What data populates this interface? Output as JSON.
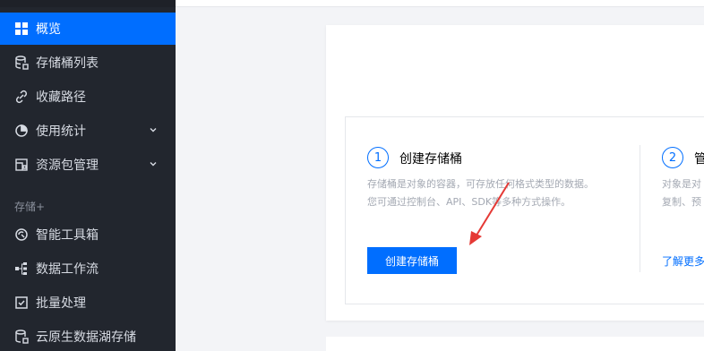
{
  "sidebar": {
    "items": [
      {
        "label": "概览",
        "icon": "grid-icon",
        "active": true
      },
      {
        "label": "存储桶列表",
        "icon": "bucket-icon"
      },
      {
        "label": "收藏路径",
        "icon": "link-icon"
      },
      {
        "label": "使用统计",
        "icon": "pie-chart-icon",
        "expandable": true
      },
      {
        "label": "资源包管理",
        "icon": "package-icon",
        "expandable": true
      },
      {
        "label": "智能工具箱",
        "icon": "toolbox-icon"
      },
      {
        "label": "数据工作流",
        "icon": "workflow-icon"
      },
      {
        "label": "批量处理",
        "icon": "checkbox-icon"
      },
      {
        "label": "云原生数据湖存储",
        "icon": "datalake-icon"
      }
    ],
    "section_label": "存储+"
  },
  "guide": {
    "step1": {
      "number": "1",
      "title": "创建存储桶",
      "desc_line1": "存储桶是对象的容器，可存放任何格式类型的数据。",
      "desc_line2": "您可通过控制台、API、SDK等多种方式操作。",
      "button": "创建存储桶"
    },
    "step2": {
      "number": "2",
      "title": "管",
      "desc_line1": "对象是对",
      "desc_line2": "复制、预",
      "link": "了解更多"
    }
  },
  "colors": {
    "accent": "#006eff",
    "sidebar_bg": "#22262e",
    "arrow": "#e53935"
  }
}
